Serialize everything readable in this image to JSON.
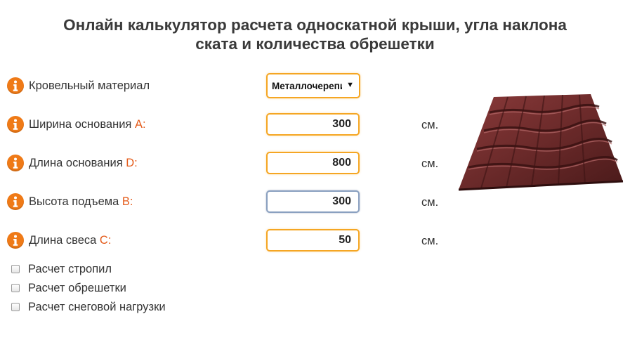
{
  "page": {
    "title_line1": "Онлайн калькулятор расчета односкатной крыши, угла наклона",
    "title_line2": "ската и количества обрешетки"
  },
  "form": {
    "material": {
      "label": "Кровельный материал",
      "selected": "Металлочерепица"
    },
    "width": {
      "label": "Ширина основания ",
      "letter": "A",
      "colon": ":",
      "value": "300",
      "unit": "см."
    },
    "length": {
      "label": "Длина основания ",
      "letter": "D",
      "colon": ":",
      "value": "800",
      "unit": "см."
    },
    "height": {
      "label": "Высота подъема ",
      "letter": "B",
      "colon": ":",
      "value": "300",
      "unit": "см."
    },
    "overhang": {
      "label": "Длина свеса ",
      "letter": "C",
      "colon": ":",
      "value": "50",
      "unit": "см."
    }
  },
  "checkboxes": [
    {
      "label": "Расчет стропил",
      "checked": false
    },
    {
      "label": "Расчет обрешетки",
      "checked": false
    },
    {
      "label": "Расчет снеговой нагрузки",
      "checked": false
    }
  ],
  "colors": {
    "accent": "#f5a623",
    "info_icon": "#ef7a17",
    "letter": "#e45b1a",
    "roof": "#6b2a2a"
  },
  "icons": {
    "info": "info-icon",
    "dropdown": "chevron-down-icon"
  }
}
